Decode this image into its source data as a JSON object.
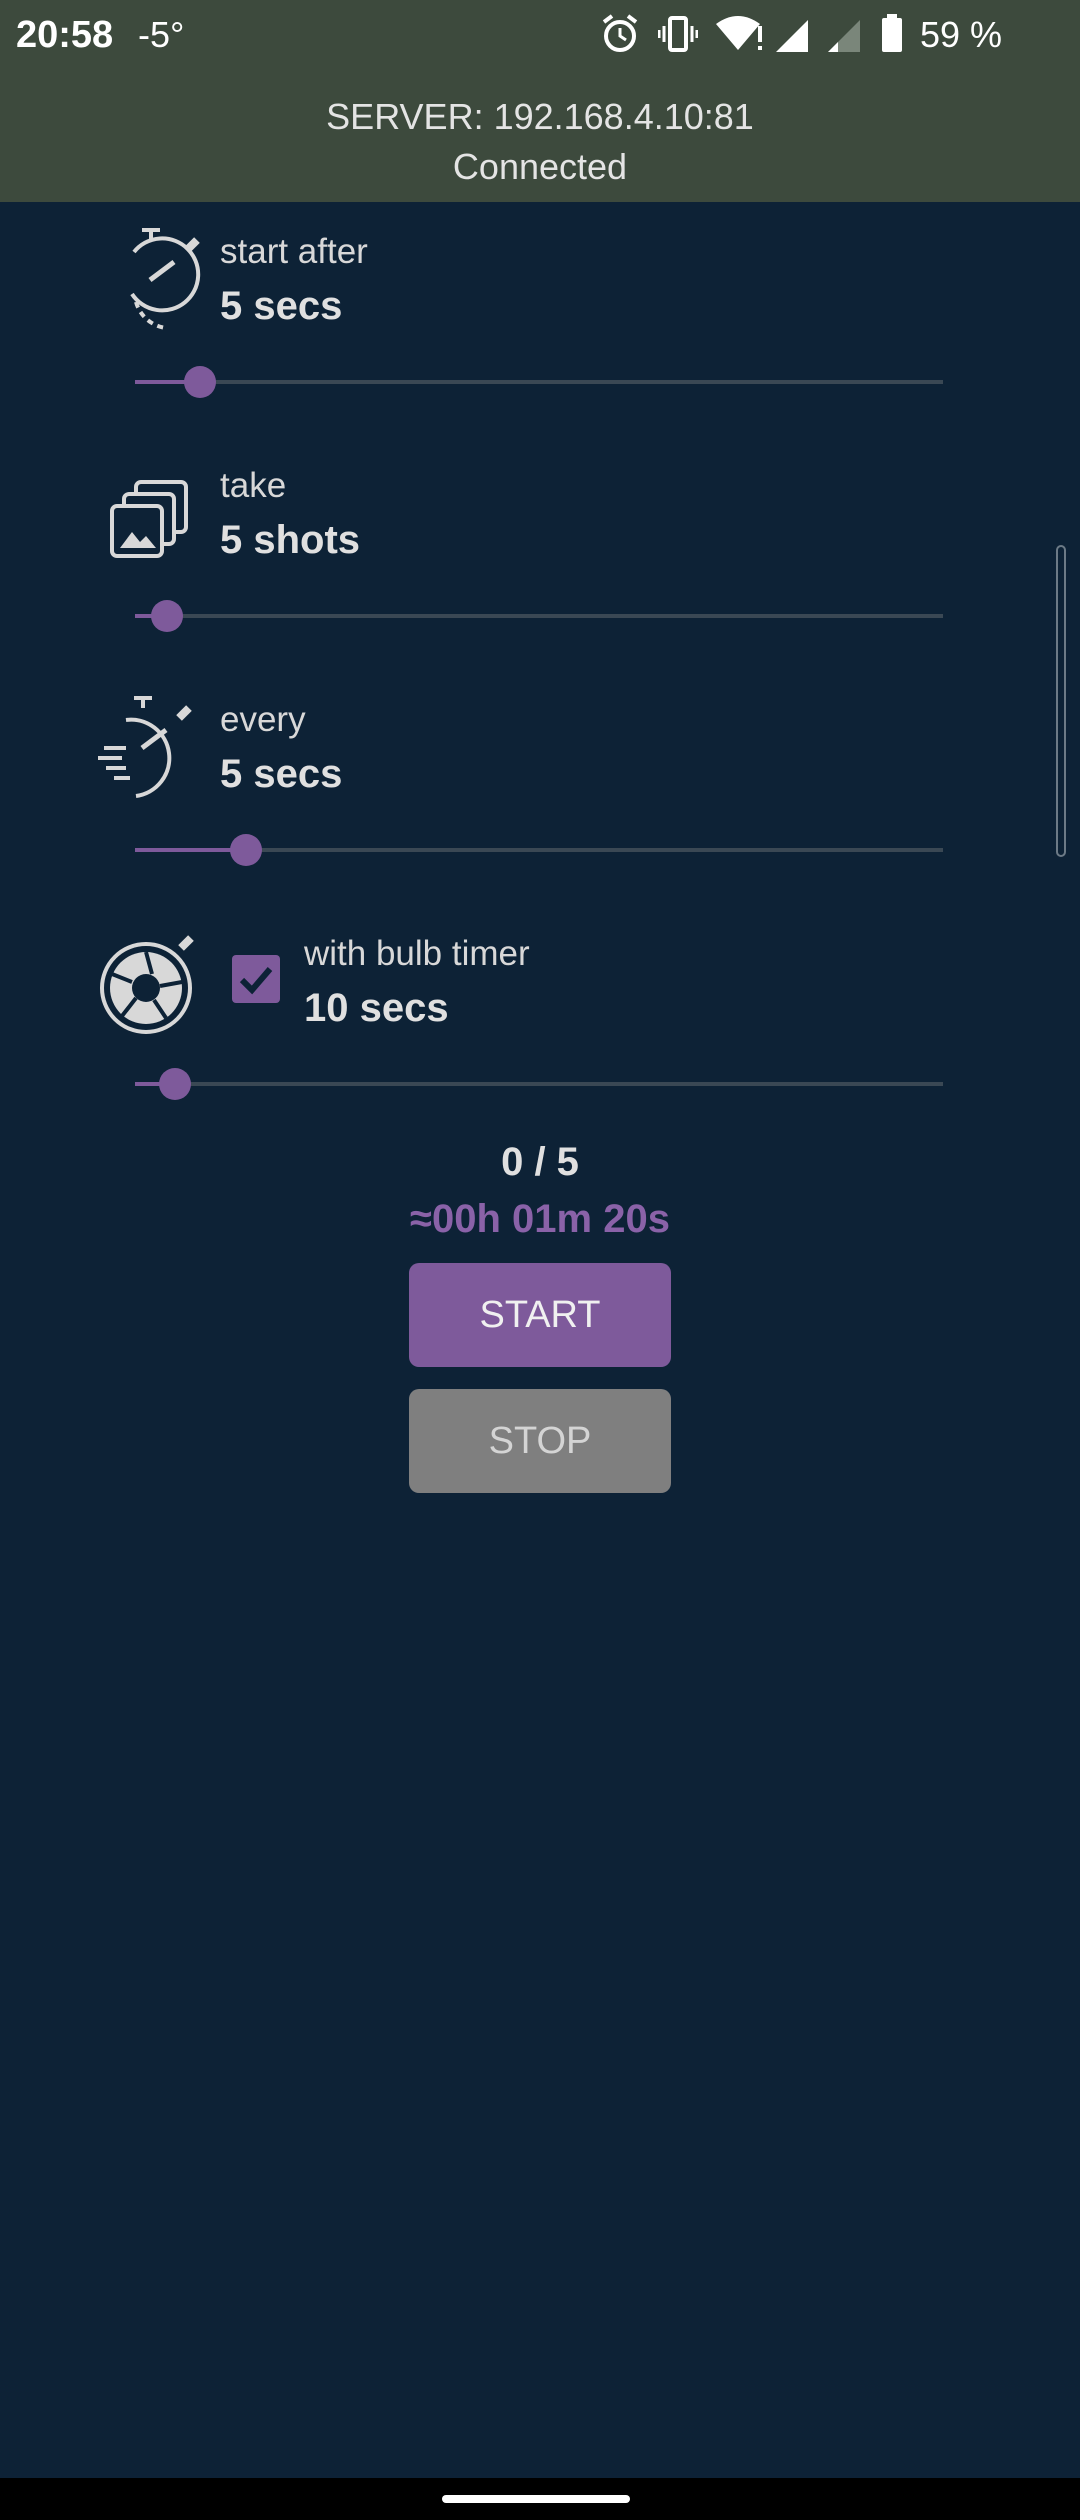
{
  "status_bar": {
    "time": "20:58",
    "temperature": "-5°",
    "battery_percent": "59 %",
    "icons": [
      "alarm-icon",
      "vibrate-icon",
      "wifi-icon",
      "signal-icon",
      "signal-weak-icon",
      "battery-icon"
    ]
  },
  "header": {
    "server": "SERVER: 192.168.4.10:81",
    "status": "Connected"
  },
  "settings": {
    "start_after": {
      "label": "start after",
      "value": "5 secs",
      "slider_level": 0.08,
      "icon": "stopwatch-icon"
    },
    "take": {
      "label": "take",
      "value": "5 shots",
      "slider_level": 0.04,
      "icon": "photo-stack-icon"
    },
    "every": {
      "label": "every",
      "value": "5 secs",
      "slider_level": 0.137,
      "icon": "fast-stopwatch-icon"
    },
    "bulb": {
      "label": "with bulb timer",
      "value": "10 secs",
      "checked": true,
      "slider_level": 0.05,
      "icon": "aperture-icon"
    }
  },
  "progress": {
    "counter": "0 / 5",
    "eta": "≈00h 01m 20s"
  },
  "buttons": {
    "start": "START",
    "stop": "STOP"
  },
  "colors": {
    "background": "#0d2236",
    "header": "#3d4a3d",
    "accent": "#7e5a9b",
    "stop_button": "#7f7f7f"
  }
}
